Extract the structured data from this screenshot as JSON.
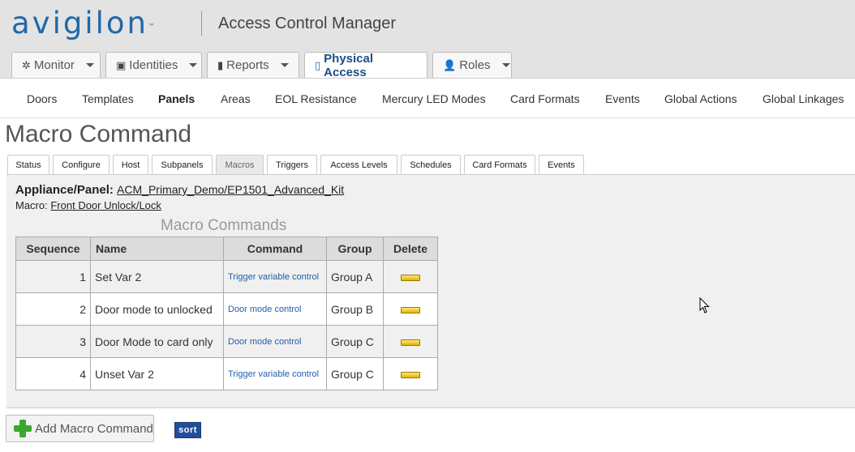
{
  "brand": {
    "logo": "avigilon",
    "tm": "™",
    "app_title": "Access Control Manager"
  },
  "main_tabs": [
    {
      "label": "Monitor",
      "icon": "alarm-icon"
    },
    {
      "label": "Identities",
      "icon": "id-card-icon"
    },
    {
      "label": "Reports",
      "icon": "bar-chart-icon"
    },
    {
      "label": "Physical Access",
      "icon": "door-icon"
    },
    {
      "label": "Roles",
      "icon": "users-icon"
    }
  ],
  "sub_nav": [
    "Doors",
    "Templates",
    "Panels",
    "Areas",
    "EOL Resistance",
    "Mercury LED Modes",
    "Card Formats",
    "Events",
    "Global Actions",
    "Global Linkages"
  ],
  "page_title": "Macro Command",
  "panel_tabs": [
    "Status",
    "Configure",
    "Host",
    "Subpanels",
    "Macros",
    "Triggers",
    "Access Levels",
    "Schedules",
    "Card Formats",
    "Events"
  ],
  "appliance": {
    "label": "Appliance/Panel:",
    "value": "ACM_Primary_Demo/EP1501_Advanced_Kit"
  },
  "macro": {
    "label": "Macro:",
    "value": "Front Door Unlock/Lock"
  },
  "table": {
    "title": "Macro Commands",
    "headers": [
      "Sequence",
      "Name",
      "Command",
      "Group",
      "Delete"
    ],
    "rows": [
      {
        "sequence": "1",
        "name": "Set Var 2",
        "command": "Trigger variable control",
        "group": "Group A"
      },
      {
        "sequence": "2",
        "name": "Door mode to unlocked",
        "command": "Door mode control",
        "group": "Group B"
      },
      {
        "sequence": "3",
        "name": "Door Mode to card only",
        "command": "Door mode control",
        "group": "Group C"
      },
      {
        "sequence": "4",
        "name": "Unset Var 2",
        "command": "Trigger variable control",
        "group": "Group C"
      }
    ]
  },
  "add_button": "Add Macro Command",
  "sort_button": "sort"
}
